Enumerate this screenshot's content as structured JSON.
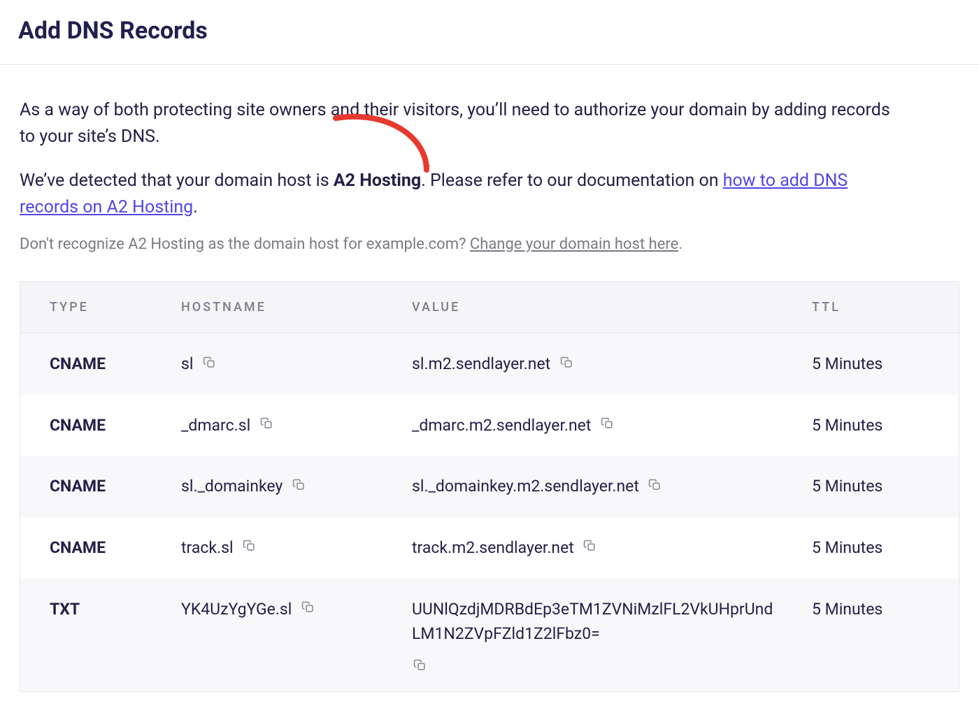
{
  "header": {
    "title": "Add DNS Records"
  },
  "intro_text": "As a way of both protecting site owners and their visitors, you’ll need to authorize your domain by adding records to your site’s DNS.",
  "detect": {
    "prefix": "We’ve detected that your domain host is ",
    "host_name": "A2 Hosting",
    "middle": ". Please refer to our documentation on ",
    "link_text": "how to add DNS records on A2 Hosting",
    "suffix": "."
  },
  "unrecognize": {
    "text": "Don't recognize A2 Hosting as the domain host for example.com? ",
    "link_text": "Change your domain host here",
    "suffix": "."
  },
  "annotation": {
    "arrow_color": "#e63a2e"
  },
  "table": {
    "headers": {
      "type": "TYPE",
      "hostname": "HOSTNAME",
      "value": "VALUE",
      "ttl": "TTL"
    },
    "rows": [
      {
        "type": "CNAME",
        "hostname": "sl",
        "value": "sl.m2.sendlayer.net",
        "ttl": "5 Minutes"
      },
      {
        "type": "CNAME",
        "hostname": "_dmarc.sl",
        "value": "_dmarc.m2.sendlayer.net",
        "ttl": "5 Minutes"
      },
      {
        "type": "CNAME",
        "hostname": "sl._domainkey",
        "value": "sl._domainkey.m2.sendlayer.net",
        "ttl": "5 Minutes"
      },
      {
        "type": "CNAME",
        "hostname": "track.sl",
        "value": "track.m2.sendlayer.net",
        "ttl": "5 Minutes"
      },
      {
        "type": "TXT",
        "hostname": "YK4UzYgYGe.sl",
        "value": "UUNlQzdjMDRBdEp3eTM1ZVNiMzlFL2VkUHprUndLM1N2ZVpFZld1Z2lFbz0=",
        "ttl": "5 Minutes"
      }
    ]
  },
  "icons": {
    "copy": "copy-icon"
  }
}
